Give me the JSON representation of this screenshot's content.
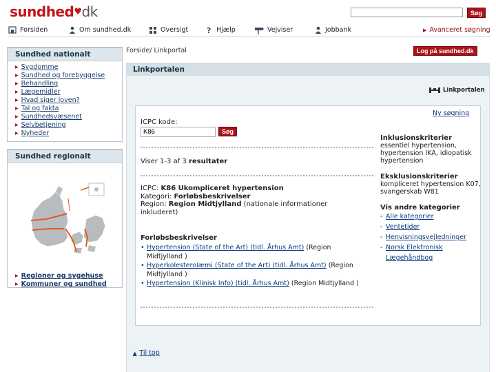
{
  "header": {
    "logo_main": "sundhed",
    "logo_dot": ".",
    "logo_tld": "dk",
    "search_button": "Søg",
    "advanced_search": "Avanceret søgning"
  },
  "topnav": {
    "items": [
      {
        "label": "Forsiden",
        "icon": "home-icon"
      },
      {
        "label": "Om sundhed.dk",
        "icon": "person-icon"
      },
      {
        "label": "Oversigt",
        "icon": "grid-icon"
      },
      {
        "label": "Hjælp",
        "icon": "help-icon"
      },
      {
        "label": "Vejviser",
        "icon": "signpost-icon"
      },
      {
        "label": "Jobbank",
        "icon": "person-icon"
      }
    ]
  },
  "national": {
    "title": "Sundhed nationalt",
    "items": [
      "Sygdomme",
      "Sundhed og forebyggelse",
      "Behandling",
      "Lægemidler",
      "Hvad siger loven?",
      "Tal og fakta",
      "Sundhedsvæsenet",
      "Selvbetjening",
      "Nyheder"
    ]
  },
  "regional": {
    "title": "Sundhed regionalt",
    "items": [
      "Regioner og sygehuse",
      "Kommuner og sundhed"
    ]
  },
  "breadcrumb": "Forside/ Linkportal",
  "login_button": "Log på sundhed.dk",
  "main": {
    "title": "Linkportalen",
    "badge": "Linkportalen",
    "new_search": "Ny søgning",
    "icpc_label": "ICPC kode:",
    "icpc_value": "K86",
    "icpc_button": "Søg",
    "results_prefix": "Viser 1-3 af 3",
    "results_suffix": "resultater",
    "icpc_line_label": "ICPC:",
    "icpc_line_value": "K86 Ukompliceret hypertension",
    "category_label": "Kategori:",
    "category_value": "Forløbsbeskrivelser",
    "region_label": "Region:",
    "region_value": "Region Midtjylland",
    "region_note": "(nationale informationer inkluderet)",
    "section_title": "Forløbsbeskrivelser",
    "descriptions": [
      {
        "link": "Hypertension (State of the Art) (tidl. Århus Amt)",
        "region": "(Region Midtjylland )"
      },
      {
        "link": "Hyperkolesterolæmi (State of the Art) (tidl. Århus Amt)",
        "region": "(Region Midtjylland )"
      },
      {
        "link": "Hypertension (Klinisk Info) (tidl. Århus Amt)",
        "region": "(Region Midtjylland )"
      }
    ],
    "to_top": "Til top"
  },
  "sidebar_info": {
    "inclusion_title": "Inklusionskriterier",
    "inclusion_text": "essentiel hypertension, hypertension IKA, idiopatisk hypertension",
    "exclusion_title": "Eksklusionskriterier",
    "exclusion_text": "kompliceret hypertension K07, svangerskab W81",
    "other_title": "Vis andre kategorier",
    "other_items": [
      "Alle kategorier",
      "Ventetider",
      "Henvisningsvejledninger",
      "Norsk Elektronisk Lægehåndbog"
    ]
  },
  "colors": {
    "brand_red": "#c4141b",
    "button_red": "#a8141a",
    "panel_bg": "#edf2f4",
    "link_blue": "#0b3a7e"
  }
}
